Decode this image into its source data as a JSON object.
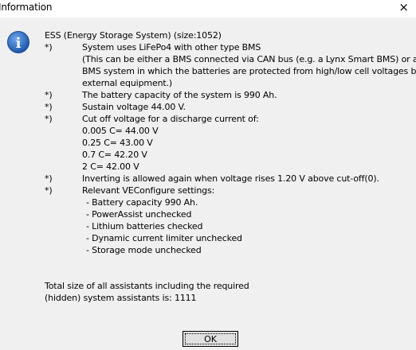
{
  "window": {
    "title": "Information",
    "close_glyph": "×"
  },
  "icon": {
    "name": "info-icon",
    "glyph": "i",
    "color": "#2a66b3"
  },
  "message": {
    "header": "ESS (Energy Storage System) (size:1052)",
    "bullets": [
      "*)",
      "*)",
      "*)",
      "*)",
      "*)",
      "*)"
    ],
    "lines": [
      "System uses LiFePo4 with other type BMS",
      "(This can be either a BMS connected via CAN bus (e.g. a Lynx Smart BMS) or a",
      "BMS system in which the batteries are protected from high/low cell voltages by",
      "external equipment.)",
      "The battery capacity of the system is 990 Ah.",
      "Sustain voltage 44.00 V.",
      "Cut off voltage for a discharge current of:",
      "0.005 C= 44.00 V",
      "0.25 C= 43.00 V",
      "0.7 C= 42.20 V",
      "2 C= 42.00 V",
      "Inverting is allowed again when voltage rises 1.20 V above cut-off(0).",
      "Relevant VEConfigure settings:",
      "- Battery capacity 990 Ah.",
      "- PowerAssist unchecked",
      "- Lithium batteries checked",
      "- Dynamic current limiter unchecked",
      "- Storage mode unchecked"
    ],
    "total": [
      "Total size of all assistants including the required",
      "(hidden) system assistants is: 1111"
    ]
  },
  "buttons": {
    "ok_label": "OK"
  }
}
